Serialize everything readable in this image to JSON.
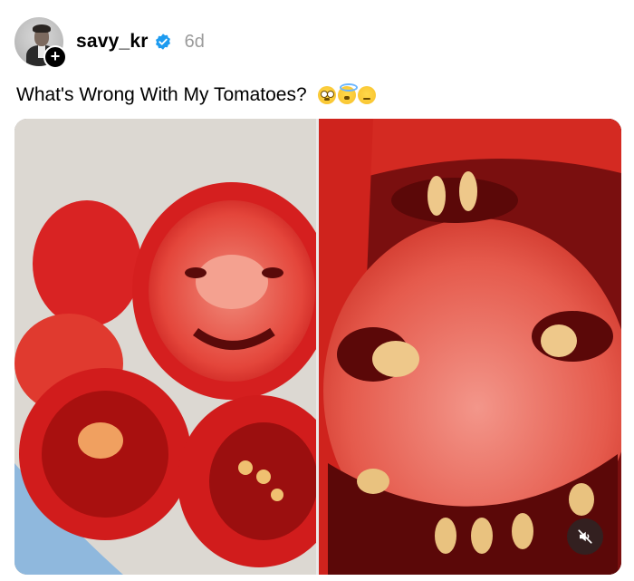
{
  "post": {
    "username": "savy_kr",
    "time": "6d",
    "caption": "What's Wrong With My Tomatoes?",
    "caption_emojis": [
      "flushed-face",
      "smiling-face-with-halo",
      "thinking-face"
    ],
    "verified": true
  },
  "media": {
    "panels": [
      "tomato-slices-photo",
      "tomato-closeup-photo"
    ],
    "muted": true
  },
  "colors": {
    "verified_blue": "#1d9bf0",
    "timestamp_gray": "#9b9b9b",
    "tomato_red": "#d51f1f"
  }
}
